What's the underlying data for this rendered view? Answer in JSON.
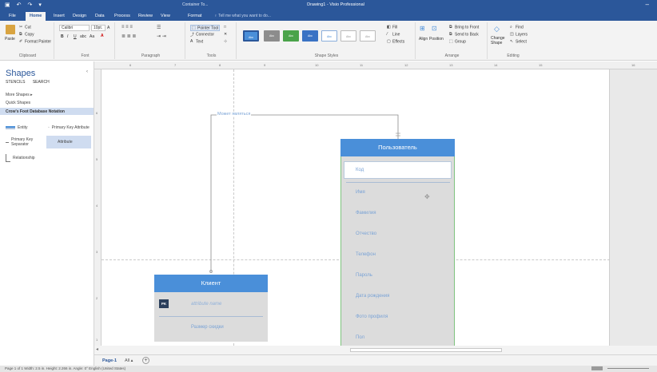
{
  "window": {
    "context_tab": "Container To...",
    "title": "Drawing1 - Visio Professional",
    "minimize": "–"
  },
  "tabs": [
    "File",
    "Home",
    "Insert",
    "Design",
    "Data",
    "Process",
    "Review",
    "View",
    "Format"
  ],
  "tell_me": "Tell me what you want to do...",
  "ribbon": {
    "clipboard": {
      "paste": "Paste",
      "cut": "Cut",
      "copy": "Copy",
      "format_painter": "Format Painter",
      "label": "Clipboard"
    },
    "font": {
      "name": "Calibri",
      "size": "10pt.",
      "bold": "B",
      "italic": "I",
      "underline": "U",
      "abc": "abc",
      "aa": "Aa",
      "label": "Font"
    },
    "paragraph": {
      "label": "Paragraph"
    },
    "tools": {
      "pointer": "Pointer Tool",
      "connector": "Connector",
      "text": "Text",
      "label": "Tools"
    },
    "shape_styles": {
      "label": "Shape Styles",
      "fill": "Fill",
      "line": "Line",
      "effects": "Effects",
      "swatch_text": "Abc"
    },
    "arrange": {
      "align": "Align",
      "position": "Position",
      "bring_front": "Bring to Front",
      "send_back": "Send to Back",
      "group": "Group",
      "label": "Arrange"
    },
    "editing": {
      "change_shape": "Change Shape",
      "find": "Find",
      "layers": "Layers",
      "select": "Select",
      "label": "Editing"
    }
  },
  "shapes_pane": {
    "title": "Shapes",
    "collapse": "‹",
    "tabs": [
      "STENCILS",
      "SEARCH"
    ],
    "more_shapes": "More Shapes",
    "quick_shapes": "Quick Shapes",
    "stencil": "Crow's Foot Database Notation",
    "masters": [
      "Entity",
      "Primary Key Attribute",
      "Primary Key Separator",
      "Attribute",
      "Relationship"
    ]
  },
  "rulers": {
    "top": [
      "6",
      "7",
      "8",
      "9",
      "10",
      "11",
      "12",
      "13",
      "14",
      "15",
      "16"
    ],
    "left": [
      "6",
      "5",
      "4",
      "3",
      "2",
      "1"
    ]
  },
  "diagram": {
    "relationship_label": "Может являться",
    "user_entity": {
      "title": "Пользователь",
      "key": "Код",
      "attributes": [
        "Имя",
        "Фамилия",
        "Отчество",
        "Телефон",
        "Пароль",
        "Дата рождения",
        "Фото профиля",
        "Пол"
      ]
    },
    "client_entity": {
      "title": "Клиент",
      "pk_badge": "PK",
      "key_attribute": "attribute name",
      "attributes": [
        "Размер скидки"
      ]
    }
  },
  "page_tabs": {
    "active": "Page-1",
    "all": "All ▴",
    "add": "+"
  },
  "status": "Page 1 of 1    Width: 2.5 in.    Height: 2.266 in.    Angle: 0°    English (United States)"
}
